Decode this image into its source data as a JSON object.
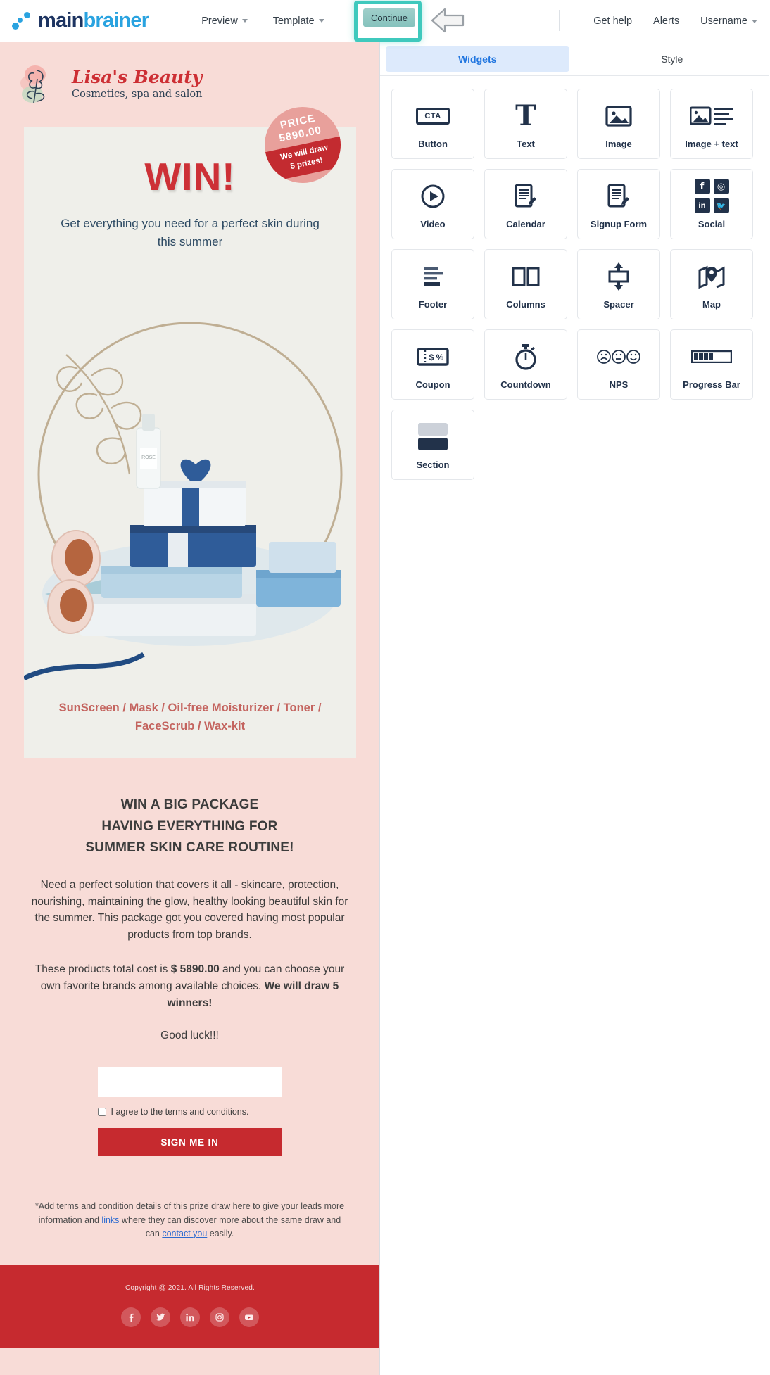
{
  "topbar": {
    "brand_main": "main",
    "brand_sub": "brainer",
    "nav": [
      {
        "label": "Preview",
        "caret": true
      },
      {
        "label": "Template",
        "caret": true
      }
    ],
    "continue_label": "Continue",
    "highlight_color": "#3fc9bd",
    "right": [
      {
        "label": "Get help"
      },
      {
        "label": "Alerts"
      },
      {
        "label": "Username",
        "caret": true
      }
    ]
  },
  "panel": {
    "tabs": [
      {
        "label": "Widgets",
        "active": true
      },
      {
        "label": "Style",
        "active": false
      }
    ],
    "widgets": [
      {
        "label": "Button",
        "icon": "cta-box-icon"
      },
      {
        "label": "Text",
        "icon": "text-t-icon"
      },
      {
        "label": "Image",
        "icon": "image-icon"
      },
      {
        "label": "Image + text",
        "icon": "image-text-icon"
      },
      {
        "label": "Video",
        "icon": "play-circle-icon"
      },
      {
        "label": "Calendar",
        "icon": "document-pencil-icon"
      },
      {
        "label": "Signup Form",
        "icon": "form-pencil-icon"
      },
      {
        "label": "Social",
        "icon": "social-networks-icon"
      },
      {
        "label": "Footer",
        "icon": "footer-lines-icon"
      },
      {
        "label": "Columns",
        "icon": "two-columns-icon"
      },
      {
        "label": "Spacer",
        "icon": "vertical-arrows-icon"
      },
      {
        "label": "Map",
        "icon": "map-pin-icon"
      },
      {
        "label": "Coupon",
        "icon": "coupon-ticket-icon"
      },
      {
        "label": "Countdown",
        "icon": "stopwatch-icon"
      },
      {
        "label": "NPS",
        "icon": "smiley-faces-icon"
      },
      {
        "label": "Progress Bar",
        "icon": "progress-bar-icon"
      },
      {
        "label": "Section",
        "icon": "section-blocks-icon"
      }
    ]
  },
  "email": {
    "logo": {
      "name": "Lisa's Beauty",
      "tagline": "Cosmetics, spa and salon",
      "icon": "rose-flower-logo"
    },
    "hero": {
      "win_text": "WIN!",
      "subhead": "Get everything you need for a perfect skin during this summer",
      "badge": {
        "line1": "PRICE",
        "line2": "5890.00",
        "line3": "We will draw",
        "line4": "5 prizes!",
        "bg_top": "#e8a09b",
        "bg_bottom": "#c32b30"
      },
      "product_list_line1": "SunScreen / Mask / Oil-free Moisturizer / Toner /",
      "product_list_line2": "FaceScrub / Wax-kit"
    },
    "headline": {
      "line1": "WIN A BIG PACKAGE",
      "line2": "HAVING EVERYTHING FOR",
      "line3": "SUMMER SKIN CARE ROUTINE!"
    },
    "paragraph1": "Need a perfect solution that covers it all - skincare, protection, nourishing, maintaining the glow, healthy looking beautiful skin for the summer. This package got you covered having most popular products from top brands.",
    "paragraph2_pre": "These products total cost is ",
    "paragraph2_bold1": "$ 5890.00",
    "paragraph2_mid": " and you can choose your own favorite brands among available choices. ",
    "paragraph2_bold2": "We will draw 5 winners!",
    "goodluck": "Good luck!!!",
    "form": {
      "input_value": "",
      "input_placeholder": "",
      "checkbox_label": "I agree to the terms and conditions.",
      "checkbox_checked": false,
      "submit_label": "SIGN ME IN",
      "submit_color": "#c62a2f"
    },
    "terms": {
      "part1": "*Add terms and condition details of this prize draw here to give your leads more information and ",
      "link1": "links",
      "part2": " where they can discover more about the same draw and can ",
      "link2": "contact you",
      "part3": " easily."
    },
    "footer": {
      "copyright": "Copyright @ 2021. All Rights Reserved.",
      "background": "#c62a2f",
      "socials": [
        {
          "name": "facebook-icon",
          "glyph": "f"
        },
        {
          "name": "twitter-icon",
          "glyph": "ᴛ"
        },
        {
          "name": "linkedin-icon",
          "glyph": "in"
        },
        {
          "name": "instagram-icon",
          "glyph": "◎"
        },
        {
          "name": "youtube-icon",
          "glyph": "▶"
        }
      ]
    }
  }
}
